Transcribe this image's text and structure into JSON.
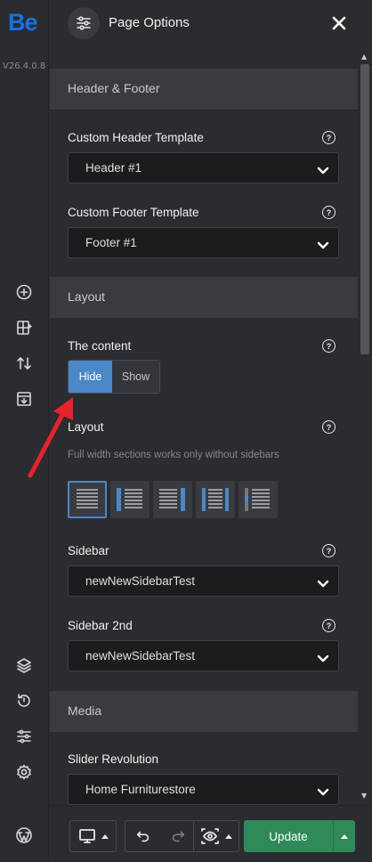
{
  "app": {
    "logo": "Be",
    "version": "V26.4.0.8"
  },
  "header": {
    "title": "Page Options"
  },
  "sections": {
    "header_footer": "Header & Footer",
    "layout": "Layout",
    "media": "Media"
  },
  "fields": {
    "custom_header": {
      "label": "Custom Header Template",
      "value": "Header #1"
    },
    "custom_footer": {
      "label": "Custom Footer Template",
      "value": "Footer #1"
    },
    "content": {
      "label": "The content",
      "options": [
        "Hide",
        "Show"
      ],
      "selected": "Hide"
    },
    "layout": {
      "label": "Layout",
      "hint": "Full width sections works only without sidebars",
      "selected_index": 0
    },
    "sidebar": {
      "label": "Sidebar",
      "value": "newNewSidebarTest"
    },
    "sidebar2": {
      "label": "Sidebar 2nd",
      "value": "newNewSidebarTest"
    },
    "slider": {
      "label": "Slider Revolution",
      "value": "Home Furniturestore"
    }
  },
  "help_glyph": "?",
  "footer": {
    "update_label": "Update"
  },
  "colors": {
    "accent": "#4a88c8",
    "update": "#2f8a59",
    "logo": "#1473e6",
    "annotation": "#e8212a"
  },
  "icons": {
    "rail": [
      "add-icon",
      "layout-add-icon",
      "sort-icon",
      "import-icon",
      "layers-icon",
      "history-icon",
      "settings-sliders-icon",
      "gear-icon",
      "wordpress-icon"
    ]
  }
}
